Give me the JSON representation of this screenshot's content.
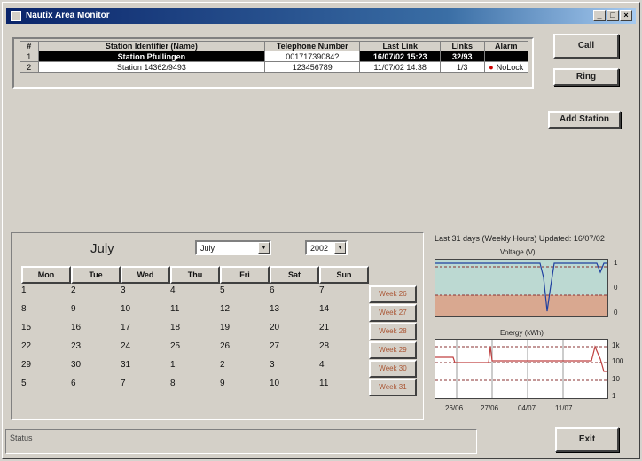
{
  "window": {
    "title": "Nautix Area Monitor"
  },
  "grid": {
    "columns": [
      "#",
      "Station Identifier (Name)",
      "Telephone Number",
      "Last Link",
      "Links",
      "Alarm"
    ],
    "rows": [
      {
        "idx": "1",
        "name": "Station Pfullingen",
        "phone": "00171739084?",
        "last_link": "16/07/02 15:23",
        "links": "32/93",
        "alarm": "",
        "alarm_dot": ""
      },
      {
        "idx": "2",
        "name": "Station 14362/9493",
        "phone": "123456789",
        "last_link": "11/07/02 14:38",
        "links": "1/3",
        "alarm": "NoLock",
        "alarm_dot": "●"
      }
    ]
  },
  "buttons": {
    "call": "Call",
    "ring": "Ring",
    "add_station": "Add Station",
    "exit": "Exit"
  },
  "calendar": {
    "month_title": "July",
    "month_select": "July",
    "year_select": "2002",
    "days": [
      "Mon",
      "Tue",
      "Wed",
      "Thu",
      "Fri",
      "Sat",
      "Sun"
    ],
    "rows": [
      {
        "dates": [
          "1",
          "2",
          "3",
          "4",
          "5",
          "6",
          "7"
        ],
        "week": "Week 26"
      },
      {
        "dates": [
          "8",
          "9",
          "10",
          "11",
          "12",
          "13",
          "14"
        ],
        "week": "Week 27"
      },
      {
        "dates": [
          "15",
          "16",
          "17",
          "18",
          "19",
          "20",
          "21"
        ],
        "week": "Week 28"
      },
      {
        "dates": [
          "22",
          "23",
          "24",
          "25",
          "26",
          "27",
          "28"
        ],
        "week": "Week 29"
      },
      {
        "dates": [
          "29",
          "30",
          "31",
          "1",
          "2",
          "3",
          "4"
        ],
        "week": "Week 30"
      },
      {
        "dates": [
          "5",
          "6",
          "7",
          "8",
          "9",
          "10",
          "11"
        ],
        "week": "Week 31"
      }
    ]
  },
  "charts": {
    "heading": "Last 31 days (Weekly Hours) Updated: 16/07/02",
    "voltage": {
      "title": "Voltage (V)",
      "ticks": [
        "1",
        "0",
        "0"
      ]
    },
    "energy": {
      "title": "Energy (kWh)",
      "ticks": [
        "1k",
        "100",
        "10",
        "1"
      ]
    },
    "x_labels": [
      "26/06",
      "27/06",
      "04/07",
      "11/07"
    ]
  },
  "status": {
    "label": "Status"
  },
  "colors": {
    "title_start": "#0a246a",
    "voltage_green": "#bcd9d2",
    "voltage_red": "#d9a890",
    "energy_line": "#c04040",
    "grid_line": "#8a3030"
  }
}
